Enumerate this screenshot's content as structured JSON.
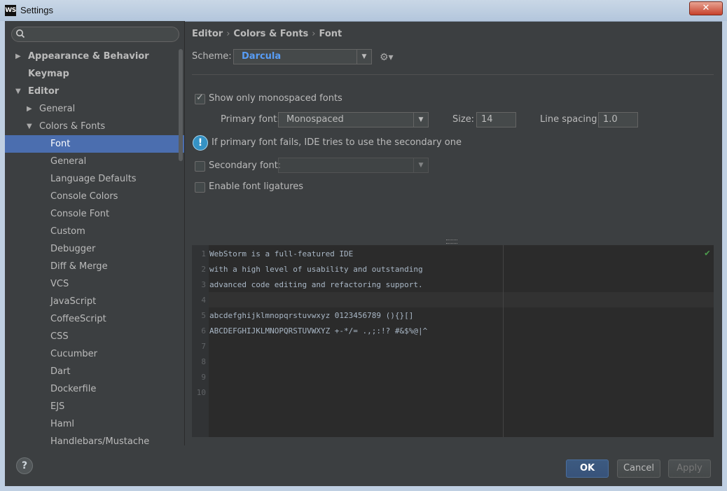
{
  "window": {
    "title": "Settings",
    "app_icon": "WS",
    "close_label": "✕"
  },
  "search": {
    "placeholder": ""
  },
  "sidebar": {
    "items": [
      {
        "label": "Appearance & Behavior",
        "arrow": "▶"
      },
      {
        "label": "Keymap",
        "arrow": ""
      },
      {
        "label": "Editor",
        "arrow": "▼"
      },
      {
        "label": "General",
        "arrow": "▶"
      },
      {
        "label": "Colors & Fonts",
        "arrow": "▼"
      },
      {
        "label": "Font",
        "arrow": ""
      },
      {
        "label": "General",
        "arrow": ""
      },
      {
        "label": "Language Defaults",
        "arrow": ""
      },
      {
        "label": "Console Colors",
        "arrow": ""
      },
      {
        "label": "Console Font",
        "arrow": ""
      },
      {
        "label": "Custom",
        "arrow": ""
      },
      {
        "label": "Debugger",
        "arrow": ""
      },
      {
        "label": "Diff & Merge",
        "arrow": ""
      },
      {
        "label": "VCS",
        "arrow": ""
      },
      {
        "label": "JavaScript",
        "arrow": ""
      },
      {
        "label": "CoffeeScript",
        "arrow": ""
      },
      {
        "label": "CSS",
        "arrow": ""
      },
      {
        "label": "Cucumber",
        "arrow": ""
      },
      {
        "label": "Dart",
        "arrow": ""
      },
      {
        "label": "Dockerfile",
        "arrow": ""
      },
      {
        "label": "EJS",
        "arrow": ""
      },
      {
        "label": "Haml",
        "arrow": ""
      },
      {
        "label": "Handlebars/Mustache",
        "arrow": ""
      }
    ]
  },
  "breadcrumb": {
    "part1": "Editor",
    "part2": "Colors & Fonts",
    "part3": "Font",
    "sep": "›"
  },
  "scheme": {
    "label": "Scheme:",
    "value": "Darcula"
  },
  "options": {
    "monospaced_label": "Show only monospaced fonts",
    "primary_font_label": "Primary font:",
    "primary_font_value": "Monospaced",
    "size_label": "Size:",
    "size_value": "14",
    "line_spacing_label": "Line spacing:",
    "line_spacing_value": "1.0",
    "info_text": "If primary font fails, IDE tries to use the secondary one",
    "secondary_font_label": "Secondary font:",
    "secondary_font_value": "",
    "ligatures_label": "Enable font ligatures"
  },
  "preview": {
    "lines": [
      {
        "num": "1",
        "text": "WebStorm is a full-featured IDE"
      },
      {
        "num": "2",
        "text": "with a high level of usability and outstanding"
      },
      {
        "num": "3",
        "text": "advanced code editing and refactoring support."
      },
      {
        "num": "4",
        "text": ""
      },
      {
        "num": "5",
        "text": "abcdefghijklmnopqrstuvwxyz 0123456789 (){}[]"
      },
      {
        "num": "6",
        "text": "ABCDEFGHIJKLMNOPQRSTUVWXYZ +-*/= .,;:!? #&$%@|^"
      },
      {
        "num": "7",
        "text": ""
      },
      {
        "num": "8",
        "text": ""
      },
      {
        "num": "9",
        "text": ""
      },
      {
        "num": "10",
        "text": ""
      }
    ]
  },
  "footer": {
    "help_label": "?",
    "ok_label": "OK",
    "cancel_label": "Cancel",
    "apply_label": "Apply"
  },
  "colors": {
    "selection": "#4b6eaf",
    "link_blue": "#589df6",
    "background": "#3c3f41",
    "editor_bg": "#2b2b2b"
  }
}
